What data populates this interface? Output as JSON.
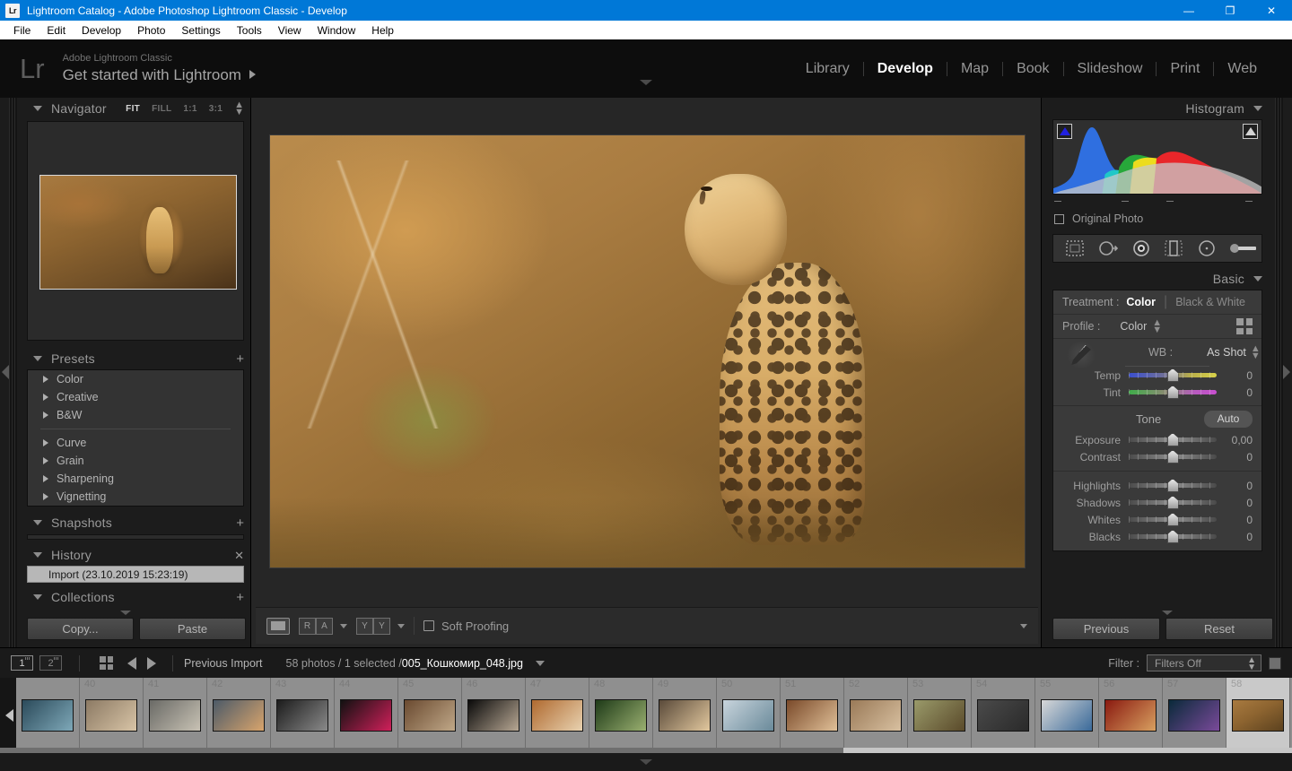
{
  "window": {
    "title": "Lightroom Catalog - Adobe Photoshop Lightroom Classic - Develop",
    "logo_text": "Lr",
    "minimize": "—",
    "restore": "❐",
    "close": "✕"
  },
  "menubar": {
    "items": [
      "File",
      "Edit",
      "Develop",
      "Photo",
      "Settings",
      "Tools",
      "View",
      "Window",
      "Help"
    ]
  },
  "identity": {
    "logo": "Lr",
    "small_line": "Adobe Lightroom Classic",
    "big_line": "Get started with Lightroom"
  },
  "modules": {
    "items": [
      {
        "label": "Library",
        "active": false
      },
      {
        "label": "Develop",
        "active": true
      },
      {
        "label": "Map",
        "active": false
      },
      {
        "label": "Book",
        "active": false
      },
      {
        "label": "Slideshow",
        "active": false
      },
      {
        "label": "Print",
        "active": false
      },
      {
        "label": "Web",
        "active": false
      }
    ]
  },
  "navigator": {
    "title": "Navigator",
    "zoom_options": [
      {
        "label": "FIT",
        "active": true
      },
      {
        "label": "FILL",
        "active": false
      },
      {
        "label": "1:1",
        "active": false
      },
      {
        "label": "3:1",
        "active": false
      }
    ]
  },
  "presets": {
    "title": "Presets",
    "add_icon": "+",
    "group_a": [
      "Color",
      "Creative",
      "B&W"
    ],
    "group_b": [
      "Curve",
      "Grain",
      "Sharpening",
      "Vignetting"
    ]
  },
  "snapshots": {
    "title": "Snapshots",
    "add_icon": "+"
  },
  "history": {
    "title": "History",
    "close_icon": "✕",
    "entries": [
      "Import (23.10.2019 15:23:19)"
    ]
  },
  "collections": {
    "title": "Collections",
    "add_icon": "+"
  },
  "left_buttons": {
    "copy": "Copy...",
    "paste": "Paste"
  },
  "histogram": {
    "title": "Histogram",
    "original_photo_label": "Original Photo",
    "shadow_clip_icon": "shadow-clipping-indicator",
    "highlight_clip_icon": "highlight-clipping-indicator"
  },
  "tool_strip": {
    "tools": [
      "crop-overlay-tool",
      "spot-removal-tool",
      "red-eye-correction-tool",
      "graduated-filter-tool",
      "radial-filter-tool",
      "adjustment-brush-tool"
    ]
  },
  "basic": {
    "title": "Basic",
    "treatment_label": "Treatment :",
    "treatment_options": [
      {
        "label": "Color",
        "active": true
      },
      {
        "label": "Black & White",
        "active": false
      }
    ],
    "profile_label": "Profile :",
    "profile_value": "Color",
    "profile_browser_icon": "profile-browser-grid-icon",
    "wb_label": "WB :",
    "wb_value": "As Shot",
    "eyedropper_icon": "white-balance-selector-icon",
    "tone_label": "Tone",
    "auto_label": "Auto",
    "wb_sliders": [
      {
        "name": "Temp",
        "value": "0",
        "pos": 50,
        "track": "temp"
      },
      {
        "name": "Tint",
        "value": "0",
        "pos": 50,
        "track": "tint"
      }
    ],
    "tone_sliders": [
      {
        "name": "Exposure",
        "value": "0,00",
        "pos": 50,
        "track": "gray"
      },
      {
        "name": "Contrast",
        "value": "0",
        "pos": 50,
        "track": "gray"
      }
    ],
    "detail_sliders": [
      {
        "name": "Highlights",
        "value": "0",
        "pos": 50,
        "track": "gray"
      },
      {
        "name": "Shadows",
        "value": "0",
        "pos": 50,
        "track": "gray"
      },
      {
        "name": "Whites",
        "value": "0",
        "pos": 50,
        "track": "gray"
      },
      {
        "name": "Blacks",
        "value": "0",
        "pos": 50,
        "track": "gray"
      }
    ]
  },
  "right_buttons": {
    "previous": "Previous",
    "reset": "Reset"
  },
  "toolbar": {
    "loupe_view_icon": "loupe-view-icon",
    "before_after_icon": "before-after-view-icon",
    "ya_icon": "copy-settings-icon",
    "soft_proofing_label": "Soft Proofing",
    "soft_proofing_checked": false,
    "toolbar_caret_icon": "toolbar-chevron-down-icon"
  },
  "filmstrip_bar": {
    "source_1": "1",
    "source_2": "2",
    "grid_icon": "grid-view-icon",
    "back_icon": "navigate-back-icon",
    "forward_icon": "navigate-forward-icon",
    "source_label": "Previous Import",
    "count_label": "58 photos / 1 selected /",
    "filename": "005_Кошкомир_048.jpg",
    "dropdown_icon": "source-dropdown-icon",
    "filter_label": "Filter :",
    "filter_value": "Filters Off"
  },
  "filmstrip": {
    "thumbs": [
      {
        "num": "",
        "selected": false,
        "c1": "#2b4a5a",
        "c2": "#7ea8b8"
      },
      {
        "num": "40",
        "selected": false,
        "c1": "#8c7a64",
        "c2": "#d8c4a6"
      },
      {
        "num": "41",
        "selected": false,
        "c1": "#6a6a66",
        "c2": "#c8c2b4"
      },
      {
        "num": "42",
        "selected": false,
        "c1": "#4c5a68",
        "c2": "#d8a46c"
      },
      {
        "num": "43",
        "selected": false,
        "c1": "#1c1c1c",
        "c2": "#8a8a8a"
      },
      {
        "num": "44",
        "selected": false,
        "c1": "#111111",
        "c2": "#d0205a"
      },
      {
        "num": "45",
        "selected": false,
        "c1": "#6a4a30",
        "c2": "#c0a888"
      },
      {
        "num": "46",
        "selected": false,
        "c1": "#0a0a0a",
        "c2": "#b8a894"
      },
      {
        "num": "47",
        "selected": false,
        "c1": "#b06a30",
        "c2": "#e8d2b0"
      },
      {
        "num": "48",
        "selected": false,
        "c1": "#1e3a18",
        "c2": "#9ab070"
      },
      {
        "num": "49",
        "selected": false,
        "c1": "#5a4a3a",
        "c2": "#e2c89e"
      },
      {
        "num": "50",
        "selected": false,
        "c1": "#c8d4dc",
        "c2": "#6a8a9a"
      },
      {
        "num": "51",
        "selected": false,
        "c1": "#7a4a2a",
        "c2": "#e0c098"
      },
      {
        "num": "52",
        "selected": false,
        "c1": "#9a7a58",
        "c2": "#d8c0a0"
      },
      {
        "num": "53",
        "selected": false,
        "c1": "#9a9a6a",
        "c2": "#5a4a2a"
      },
      {
        "num": "54",
        "selected": false,
        "c1": "#4a4a4a",
        "c2": "#2a2a2a"
      },
      {
        "num": "55",
        "selected": false,
        "c1": "#d8d8d8",
        "c2": "#3a6a9a"
      },
      {
        "num": "56",
        "selected": false,
        "c1": "#8a1a10",
        "c2": "#d8a060"
      },
      {
        "num": "57",
        "selected": false,
        "c1": "#0a2a3a",
        "c2": "#7a4a9a"
      },
      {
        "num": "58",
        "selected": true,
        "c1": "#8a7a3a",
        "c2": "#d8c070"
      }
    ]
  }
}
